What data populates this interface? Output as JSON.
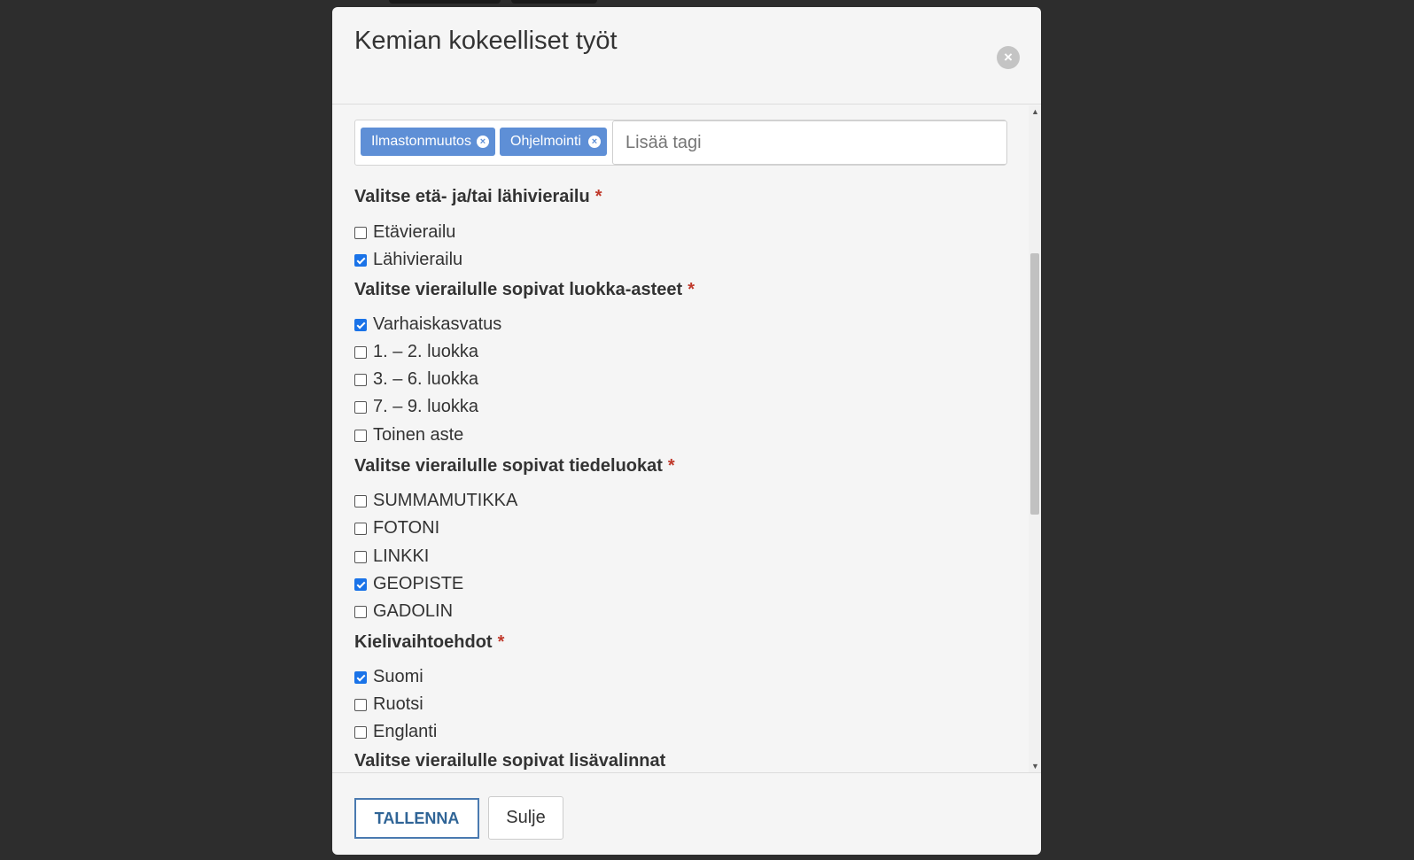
{
  "modal": {
    "title": "Kemian kokeelliset työt",
    "close_symbol": "×"
  },
  "tags": {
    "items": [
      {
        "label": "Ilmastonmuutos",
        "remove_symbol": "×"
      },
      {
        "label": "Ohjelmointi",
        "remove_symbol": "×"
      }
    ],
    "placeholder": "Lisää tagi"
  },
  "sections": {
    "visit_type": {
      "title": "Valitse etä- ja/tai lähivierailu",
      "required": "*",
      "options": [
        {
          "label": "Etävierailu",
          "checked": false
        },
        {
          "label": "Lähivierailu",
          "checked": true
        }
      ]
    },
    "grades": {
      "title": "Valitse vierailulle sopivat luokka-asteet",
      "required": "*",
      "options": [
        {
          "label": "Varhaiskasvatus",
          "checked": true
        },
        {
          "label": "1. – 2. luokka",
          "checked": false
        },
        {
          "label": "3. – 6. luokka",
          "checked": false
        },
        {
          "label": "7. – 9. luokka",
          "checked": false
        },
        {
          "label": "Toinen aste",
          "checked": false
        }
      ]
    },
    "science_classes": {
      "title": "Valitse vierailulle sopivat tiedeluokat",
      "required": "*",
      "options": [
        {
          "label": "SUMMAMUTIKKA",
          "checked": false
        },
        {
          "label": "FOTONI",
          "checked": false
        },
        {
          "label": "LINKKI",
          "checked": false
        },
        {
          "label": "GEOPISTE",
          "checked": true
        },
        {
          "label": "GADOLIN",
          "checked": false
        }
      ]
    },
    "languages": {
      "title": "Kielivaihtoehdot",
      "required": "*",
      "options": [
        {
          "label": "Suomi",
          "checked": true
        },
        {
          "label": "Ruotsi",
          "checked": false
        },
        {
          "label": "Englanti",
          "checked": false
        }
      ]
    },
    "extras": {
      "title": "Valitse vierailulle sopivat lisävalinnat"
    }
  },
  "scrollbar": {
    "up": "▲",
    "down": "▼"
  },
  "footer": {
    "save_label": "TALLENNA",
    "close_label": "Sulje"
  },
  "colors": {
    "backdrop": "#2d2d2d",
    "tag": "#5e8fd6",
    "checkbox_checked": "#1a73e8",
    "required": "#c0392b",
    "save_border": "#4a7ab0"
  }
}
